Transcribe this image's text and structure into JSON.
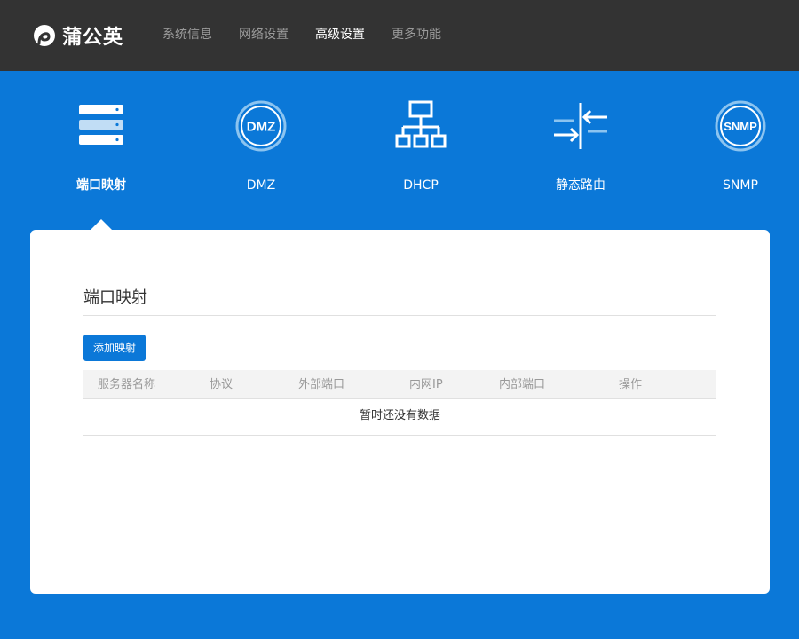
{
  "header": {
    "brand": "蒲公英",
    "nav": [
      {
        "label": "系统信息",
        "active": false
      },
      {
        "label": "网络设置",
        "active": false
      },
      {
        "label": "高级设置",
        "active": true
      },
      {
        "label": "更多功能",
        "active": false
      }
    ]
  },
  "features": [
    {
      "label": "端口映射",
      "icon": "server-stack-icon",
      "active": true
    },
    {
      "label": "DMZ",
      "icon": "dmz-icon",
      "active": false
    },
    {
      "label": "DHCP",
      "icon": "network-tree-icon",
      "active": false
    },
    {
      "label": "静态路由",
      "icon": "route-arrows-icon",
      "active": false
    },
    {
      "label": "SNMP",
      "icon": "snmp-icon",
      "active": false
    }
  ],
  "panel": {
    "title": "端口映射",
    "add_button": "添加映射",
    "columns": [
      "服务器名称",
      "协议",
      "外部端口",
      "内网IP",
      "内部端口",
      "操作"
    ],
    "empty_text": "暂时还没有数据"
  },
  "colors": {
    "accent": "#0b78d8",
    "topbar": "#333333",
    "nav_inactive": "#9a9a9a",
    "nav_active": "#ffffff"
  }
}
